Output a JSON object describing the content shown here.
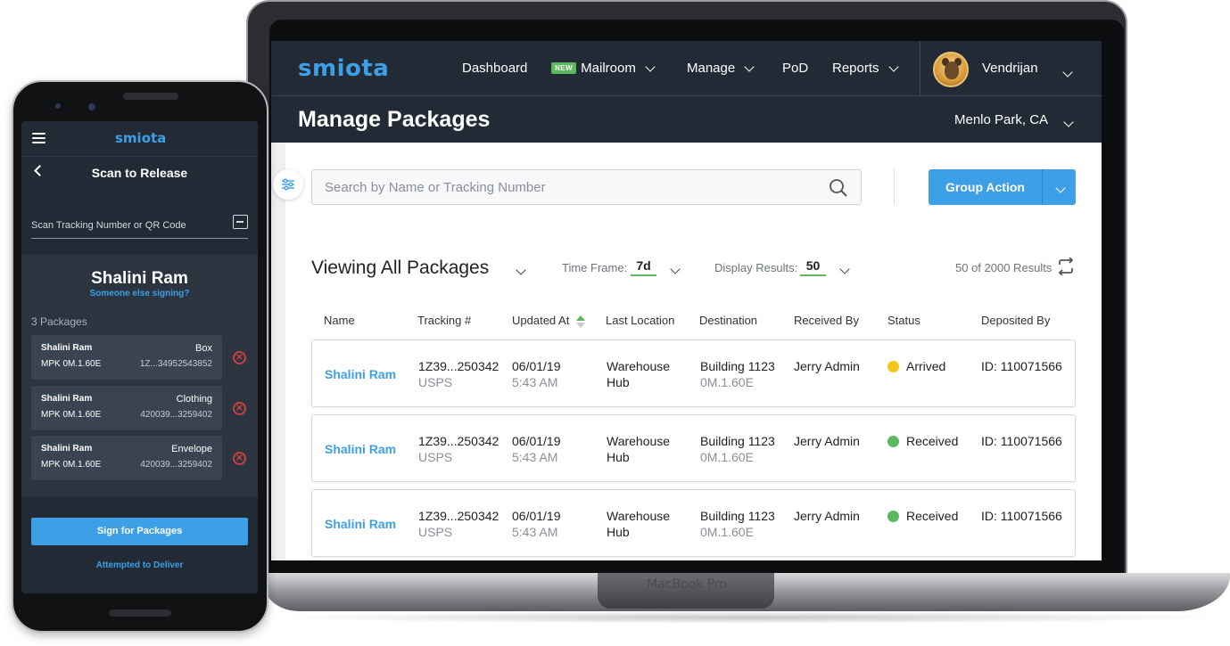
{
  "laptop": {
    "label": "MacBook Pro",
    "nav": {
      "logo": "smiota",
      "items": [
        {
          "label": "Dashboard",
          "badge": "",
          "has_dropdown": false
        },
        {
          "label": "Mailroom",
          "badge": "NEW",
          "has_dropdown": true
        },
        {
          "label": "Manage",
          "badge": "",
          "has_dropdown": true
        },
        {
          "label": "PoD",
          "badge": "",
          "has_dropdown": false
        },
        {
          "label": "Reports",
          "badge": "",
          "has_dropdown": true
        }
      ],
      "user_name": "Vendrijan"
    },
    "page_title": "Manage Packages",
    "location": "Menlo Park, CA",
    "search": {
      "placeholder": "Search by Name or Tracking Number",
      "value": ""
    },
    "group_action_label": "Group Action",
    "viewing_label": "Viewing All Packages",
    "time_frame": {
      "label": "Time Frame:",
      "value": "7d"
    },
    "display_results": {
      "label": "Display Results:",
      "value": "50"
    },
    "results_text": "50 of 2000 Results",
    "table": {
      "headers": [
        "Name",
        "Tracking #",
        "Updated At",
        "Last Location",
        "Destination",
        "Received By",
        "Status",
        "Deposited By"
      ],
      "rows": [
        {
          "name": "Shalini Ram",
          "tracking": "1Z39...250342",
          "carrier": "USPS",
          "date": "06/01/19",
          "time": "5:43 AM",
          "location_line1": "Warehouse",
          "location_line2": "Hub",
          "destination": "Building 1123",
          "dest_code": "0M.1.60E",
          "received_by": "Jerry Admin",
          "status": "Arrived",
          "status_color": "#f5c518",
          "deposited_by": "ID: 110071566"
        },
        {
          "name": "Shalini Ram",
          "tracking": "1Z39...250342",
          "carrier": "USPS",
          "date": "06/01/19",
          "time": "5:43 AM",
          "location_line1": "Warehouse",
          "location_line2": "Hub",
          "destination": "Building 1123",
          "dest_code": "0M.1.60E",
          "received_by": "Jerry Admin",
          "status": "Received",
          "status_color": "#5cb85c",
          "deposited_by": "ID: 110071566"
        },
        {
          "name": "Shalini Ram",
          "tracking": "1Z39...250342",
          "carrier": "USPS",
          "date": "06/01/19",
          "time": "5:43 AM",
          "location_line1": "Warehouse",
          "location_line2": "Hub",
          "destination": "Building 1123",
          "dest_code": "0M.1.60E",
          "received_by": "Jerry Admin",
          "status": "Received",
          "status_color": "#5cb85c",
          "deposited_by": "ID: 110071566"
        }
      ]
    }
  },
  "phone": {
    "logo": "smiota",
    "title": "Scan to Release",
    "scan_label": "Scan Tracking Number or QR Code",
    "recipient": "Shalini Ram",
    "someone_else": "Someone else signing?",
    "packages_count": "3 Packages",
    "packages": [
      {
        "name": "Shalini Ram",
        "type": "Box",
        "code": "MPK 0M.1.60E",
        "tracking": "1Z...34952543852"
      },
      {
        "name": "Shalini Ram",
        "type": "Clothing",
        "code": "MPK 0M.1.60E",
        "tracking": "420039...3259402"
      },
      {
        "name": "Shalini Ram",
        "type": "Envelope",
        "code": "MPK 0M.1.60E",
        "tracking": "420039...3259402"
      }
    ],
    "sign_button": "Sign for Packages",
    "attempted_link": "Attempted to Deliver"
  },
  "colors": {
    "accent": "#3d9fe6",
    "nav_bg": "#222a35",
    "arrived": "#f5c518",
    "received": "#5cb85c"
  }
}
